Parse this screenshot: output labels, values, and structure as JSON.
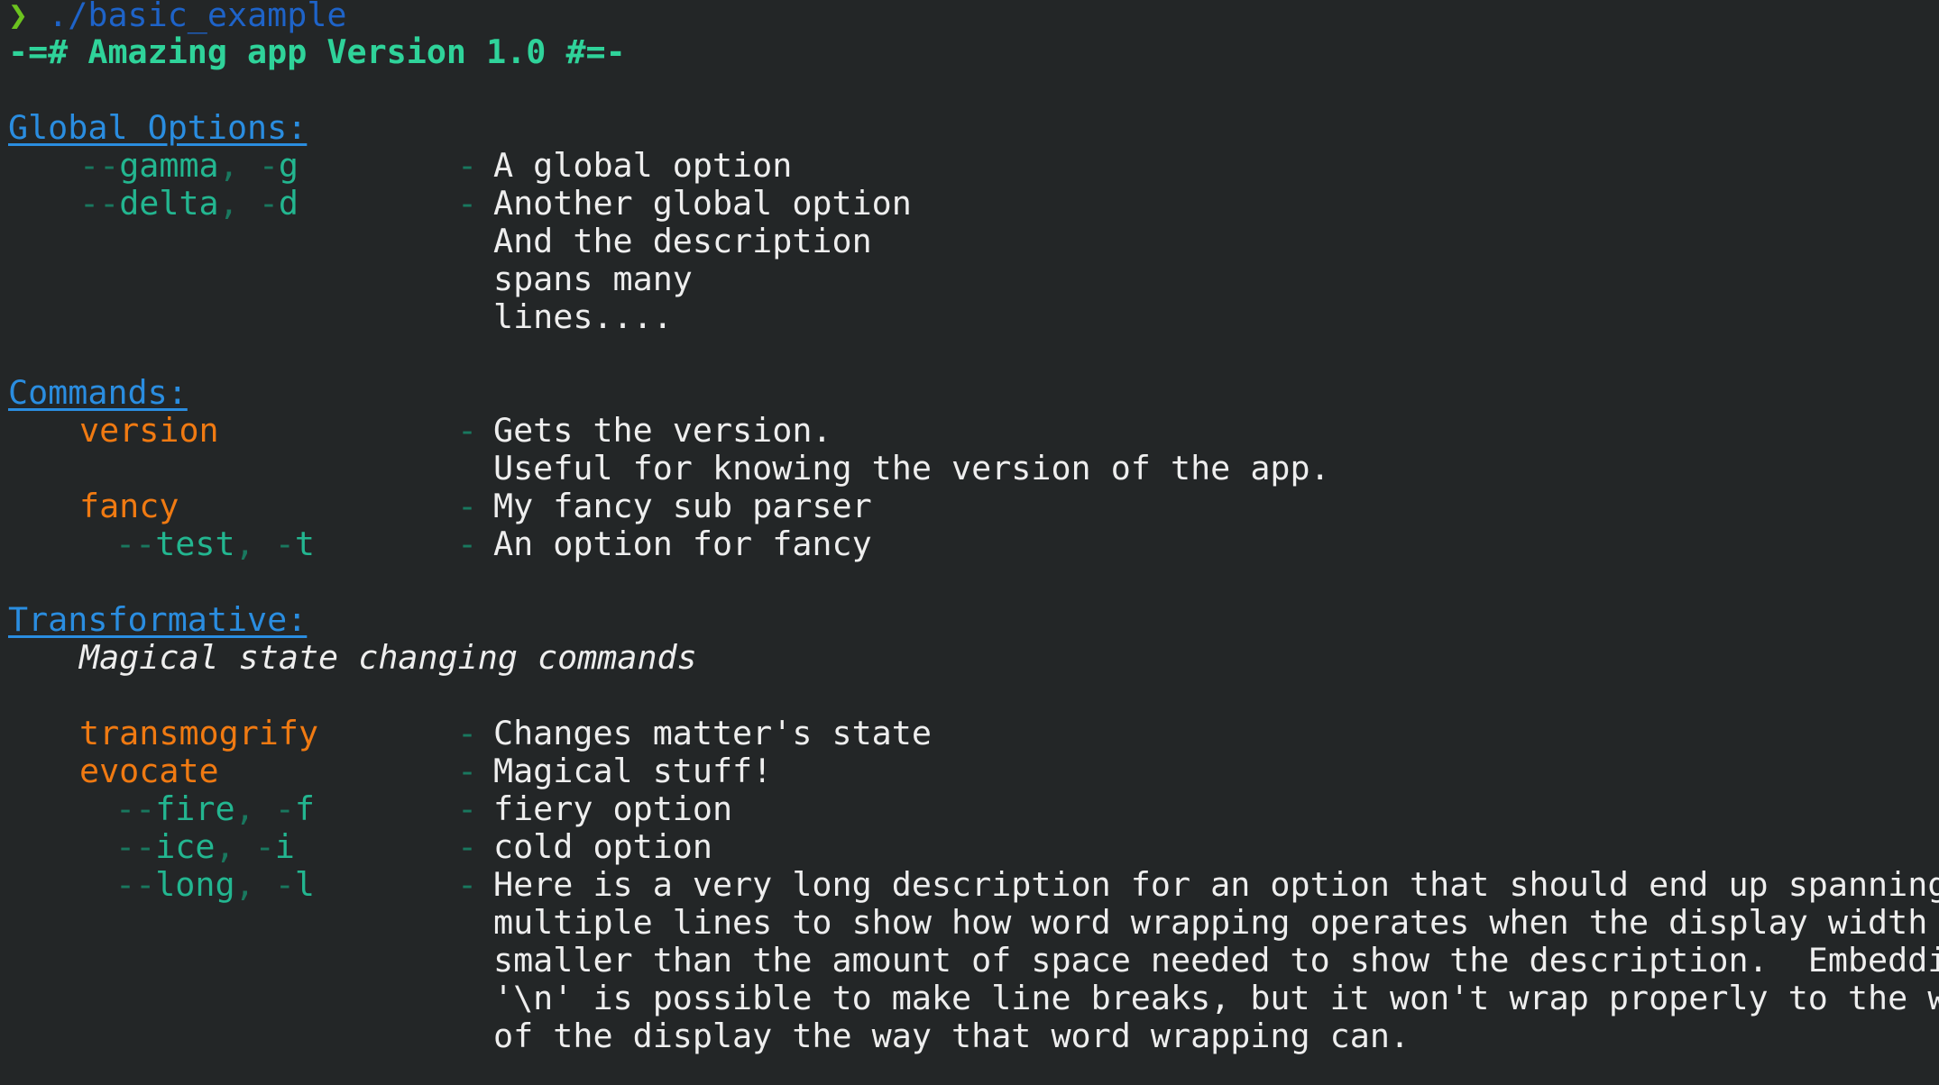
{
  "prompt": {
    "symbol": "❯",
    "command": "./basic_example"
  },
  "title": "-=# Amazing app Version 1.0 #=-",
  "separator": "-",
  "global": {
    "header": "Global Options:",
    "options": [
      {
        "long": "gamma",
        "short": "g",
        "desc": [
          "A global option"
        ]
      },
      {
        "long": "delta",
        "short": "d",
        "desc": [
          "Another global option",
          "And the description",
          "spans many",
          "lines...."
        ]
      }
    ]
  },
  "commands": {
    "header": "Commands:",
    "version": {
      "name": "version",
      "desc": [
        "Gets the version.",
        "Useful for knowing the version of the app."
      ]
    },
    "fancy": {
      "name": "fancy",
      "desc": [
        "My fancy sub parser"
      ],
      "option": {
        "long": "test",
        "short": "t",
        "desc": [
          "An option for fancy"
        ]
      }
    }
  },
  "transformative": {
    "header": "Transformative:",
    "subtitle": "Magical state changing commands",
    "transmogrify": {
      "name": "transmogrify",
      "desc": [
        "Changes matter's state"
      ]
    },
    "evocate": {
      "name": "evocate",
      "desc": [
        "Magical stuff!"
      ],
      "options": [
        {
          "long": "fire",
          "short": "f",
          "desc": [
            "fiery option"
          ]
        },
        {
          "long": "ice",
          "short": "i",
          "desc": [
            "cold option"
          ]
        },
        {
          "long": "long",
          "short": "l",
          "desc": [
            "Here is a very long description for an option that should end up spanning",
            "multiple lines to show how word wrapping operates when the display width is",
            "smaller than the amount of space needed to show the description.  Embedding a",
            "'\\n' is possible to make line breaks, but it won't wrap properly to the width",
            "of the display the way that word wrapping can."
          ]
        }
      ]
    }
  },
  "colors": {
    "background": "#232627",
    "text": "#eeeeee",
    "prompt_arrow": "#6cc31f",
    "prompt_command": "#1e63c8",
    "title": "#2fd39a",
    "section_header": "#2a8de0",
    "option": "#23b690",
    "option_dim": "#19785f",
    "command": "#f07a12"
  }
}
